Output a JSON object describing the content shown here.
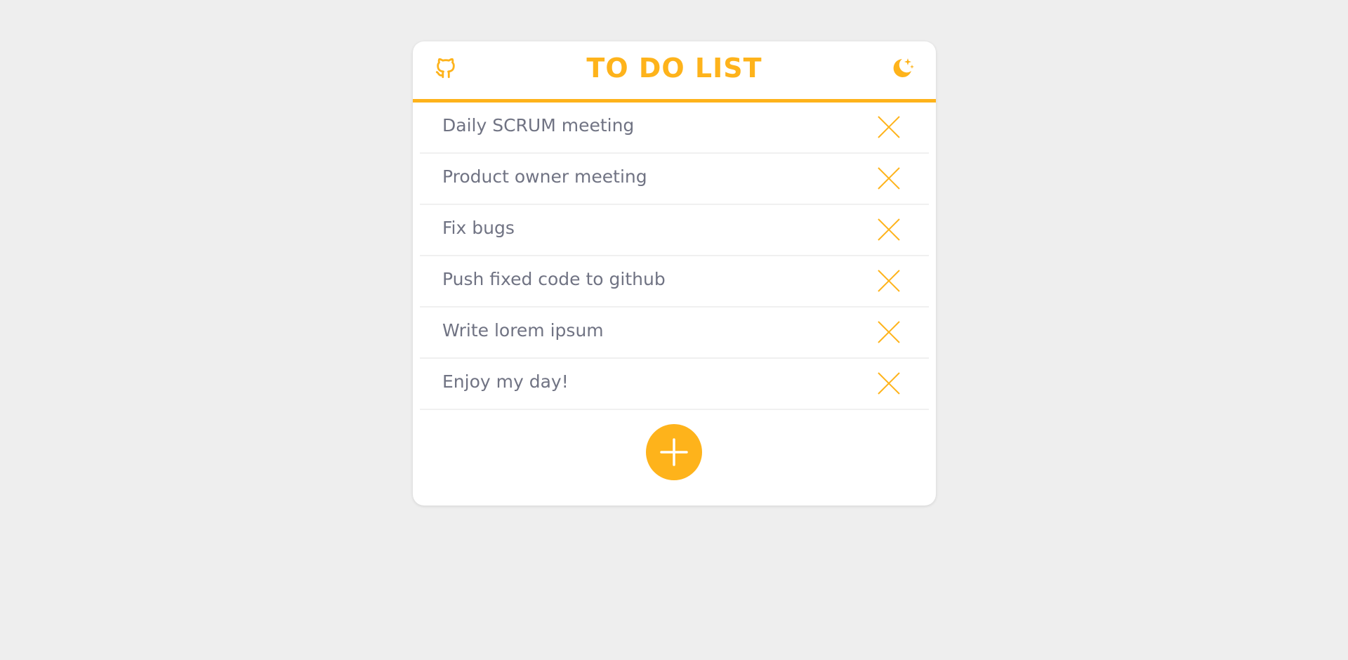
{
  "header": {
    "title": "TO DO LIST",
    "left_icon": "github-icon",
    "right_icon": "moon-icon"
  },
  "todos": [
    {
      "label": "Daily SCRUM meeting"
    },
    {
      "label": "Product owner meeting"
    },
    {
      "label": "Fix bugs"
    },
    {
      "label": "Push fixed code to github"
    },
    {
      "label": "Write lorem ipsum"
    },
    {
      "label": "Enjoy my day!"
    }
  ],
  "actions": {
    "delete_icon": "close-icon",
    "add_icon": "plus-icon"
  },
  "colors": {
    "accent": "#feb31b",
    "text": "#707383",
    "background": "#eeeeee",
    "card": "#ffffff"
  }
}
